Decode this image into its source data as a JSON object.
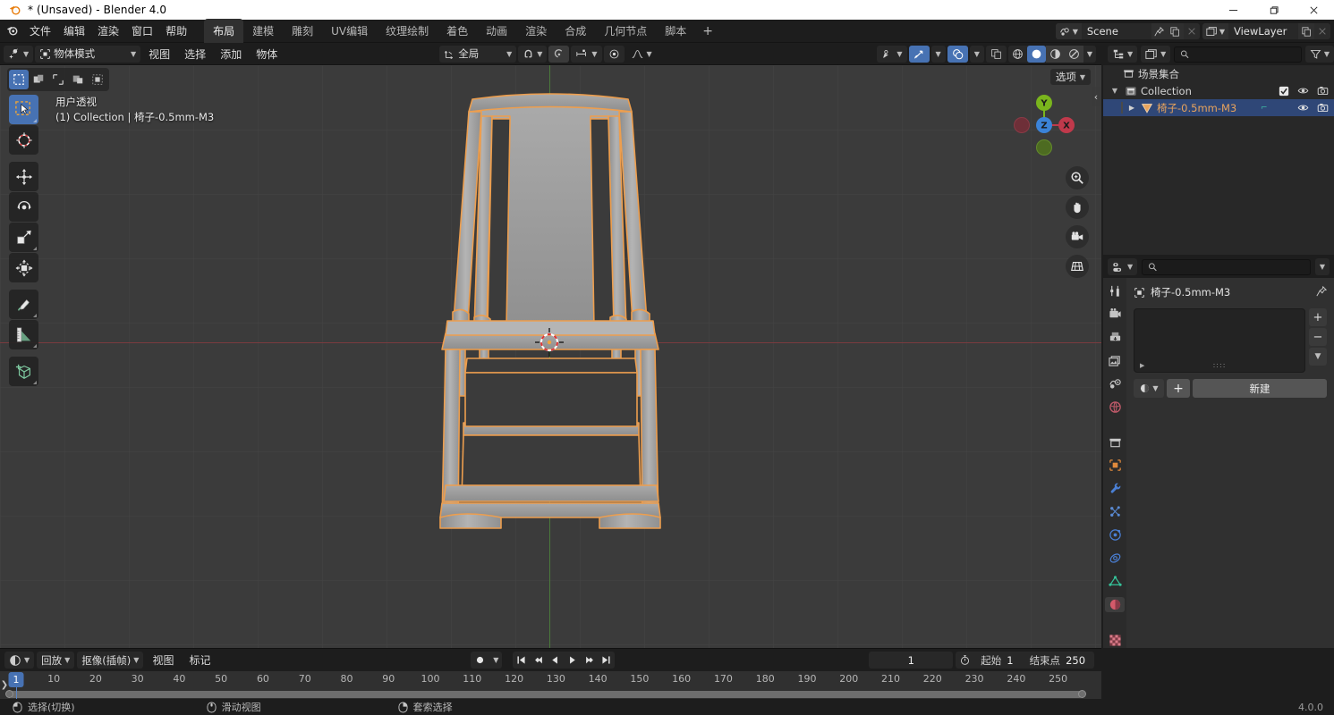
{
  "window": {
    "title": "* (Unsaved) - Blender 4.0",
    "minimize": "—",
    "maximize": "❐",
    "close": "✕"
  },
  "topbar": {
    "menus": [
      "文件",
      "编辑",
      "渲染",
      "窗口",
      "帮助"
    ],
    "workspaces": [
      "布局",
      "建模",
      "雕刻",
      "UV编辑",
      "纹理绘制",
      "着色",
      "动画",
      "渲染",
      "合成",
      "几何节点",
      "脚本"
    ],
    "active_workspace": "布局",
    "add_workspace": "+",
    "scene_name": "Scene",
    "viewlayer_name": "ViewLayer"
  },
  "viewport_header": {
    "mode": "物体模式",
    "menus": [
      "视图",
      "选择",
      "添加",
      "物体"
    ],
    "transform_orientation": "全局",
    "options_label": "选项"
  },
  "viewport": {
    "overlay_line1": "用户透视",
    "overlay_line2": "(1) Collection | 椅子-0.5mm-M3",
    "gizmo": {
      "x": "X",
      "y": "Y",
      "z": "Z"
    },
    "tools": [
      "tweak-select-tool",
      "cursor-tool",
      "move-tool",
      "rotate-tool",
      "scale-tool",
      "transform-tool",
      "annotate-tool",
      "measure-tool",
      "add-cube-tool"
    ],
    "background": "#3b3b3b",
    "object_outline_color": "#ed9e4e",
    "mesh_color": "#a3a3a3"
  },
  "outliner": {
    "root": "场景集合",
    "rows": [
      {
        "label": "Collection",
        "type": "collection",
        "indent": 1,
        "expanded": true,
        "checkbox": true
      },
      {
        "label": "椅子-0.5mm-M3",
        "type": "object",
        "indent": 2,
        "expanded": false,
        "selected": true
      }
    ]
  },
  "properties": {
    "object_name": "椅子-0.5mm-M3",
    "new_button": "新建",
    "tabs": [
      "tool-tab",
      "render-tab",
      "output-tab",
      "viewlayer-tab",
      "scene-tab",
      "world-tab",
      "collection-tab",
      "object-tab",
      "modifier-tab",
      "particles-tab",
      "physics-tab",
      "constraints-tab",
      "data-tab",
      "material-tab",
      "texture-tab"
    ],
    "active_tab": "material-tab"
  },
  "timeline": {
    "editor_menus": [
      "回放",
      "抠像(插帧)",
      "视图",
      "标记"
    ],
    "current_frame": "1",
    "start_label": "起始",
    "start_value": "1",
    "end_label": "结束点",
    "end_value": "250",
    "ticks": [
      10,
      20,
      30,
      40,
      50,
      60,
      70,
      80,
      90,
      100,
      110,
      120,
      130,
      140,
      150,
      160,
      170,
      180,
      190,
      200,
      210,
      220,
      230,
      240,
      250
    ],
    "frame_marker": "1"
  },
  "statusbar": {
    "hints": [
      "选择(切换)",
      "滑动视图",
      "套索选择"
    ],
    "version": "4.0.0"
  }
}
